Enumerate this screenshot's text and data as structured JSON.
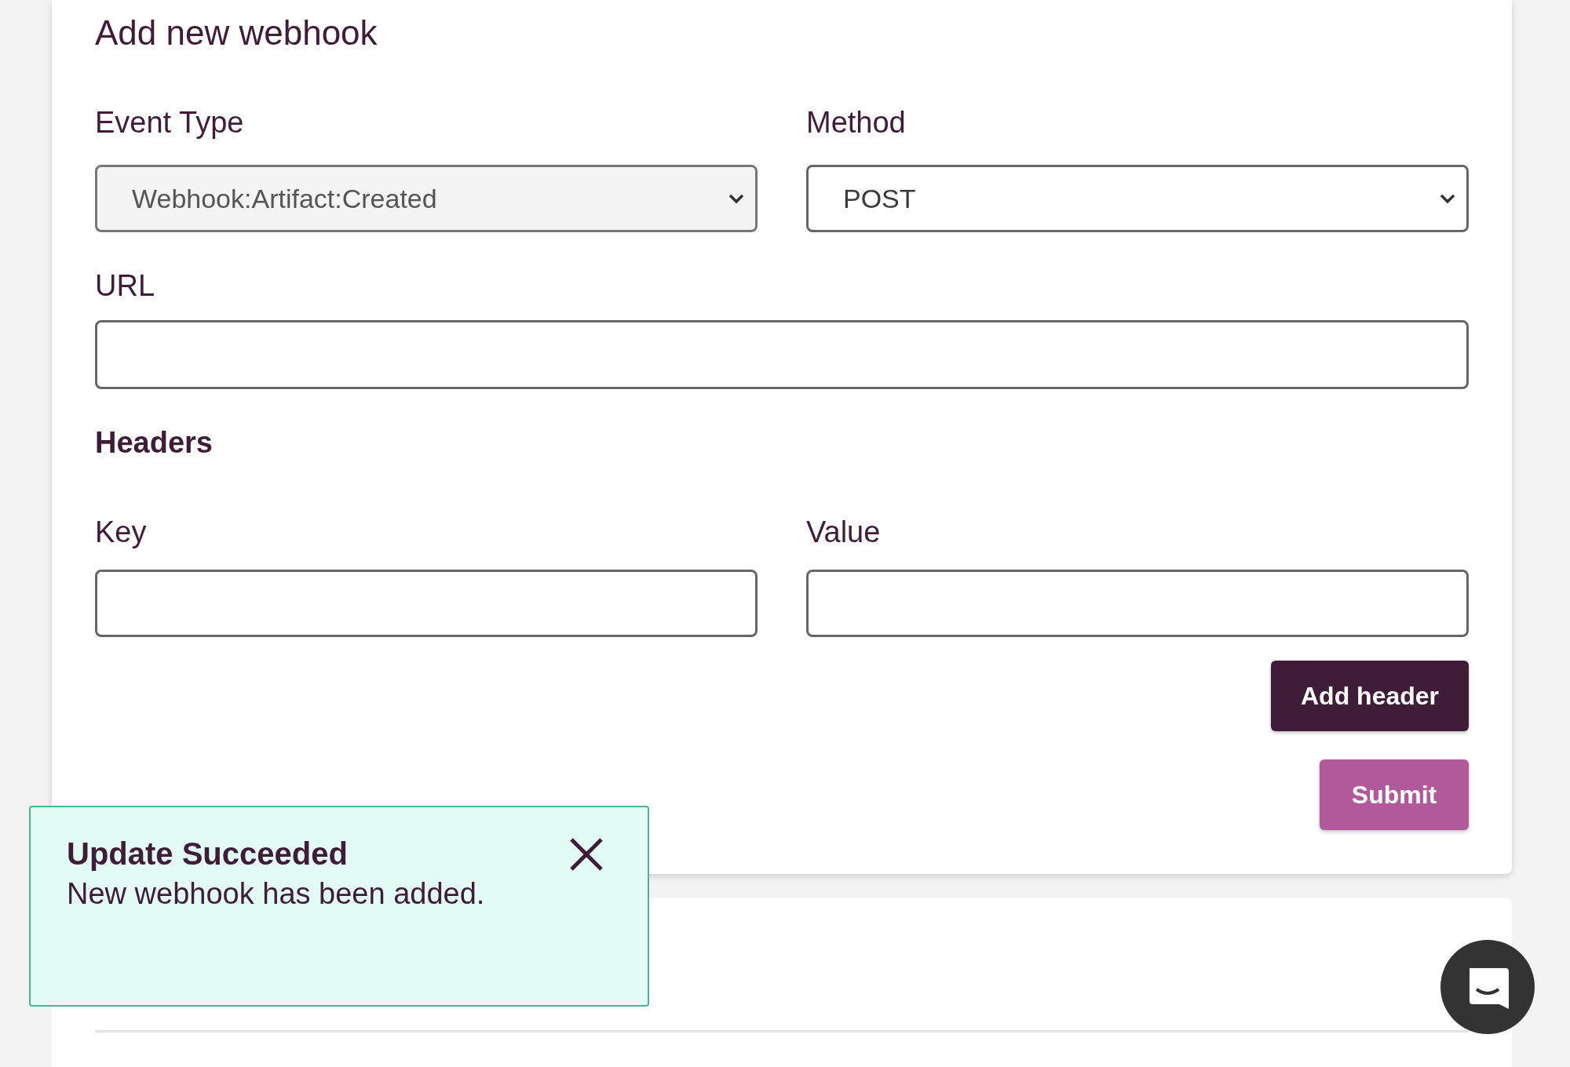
{
  "form": {
    "title": "Add new webhook",
    "selects": [
      {
        "label": "Event Type",
        "value": "Webhook:Artifact:Created",
        "disabled": true
      },
      {
        "label": "Method",
        "value": "POST",
        "disabled": false
      }
    ],
    "url": {
      "label": "URL"
    },
    "headers": {
      "title": "Headers",
      "fields": [
        {
          "label": "Key"
        },
        {
          "label": "Value"
        }
      ]
    },
    "add_header_button": "Add header",
    "submit_button": "Submit"
  },
  "toast": {
    "title": "Update Succeeded",
    "message": "New webhook has been added."
  }
}
